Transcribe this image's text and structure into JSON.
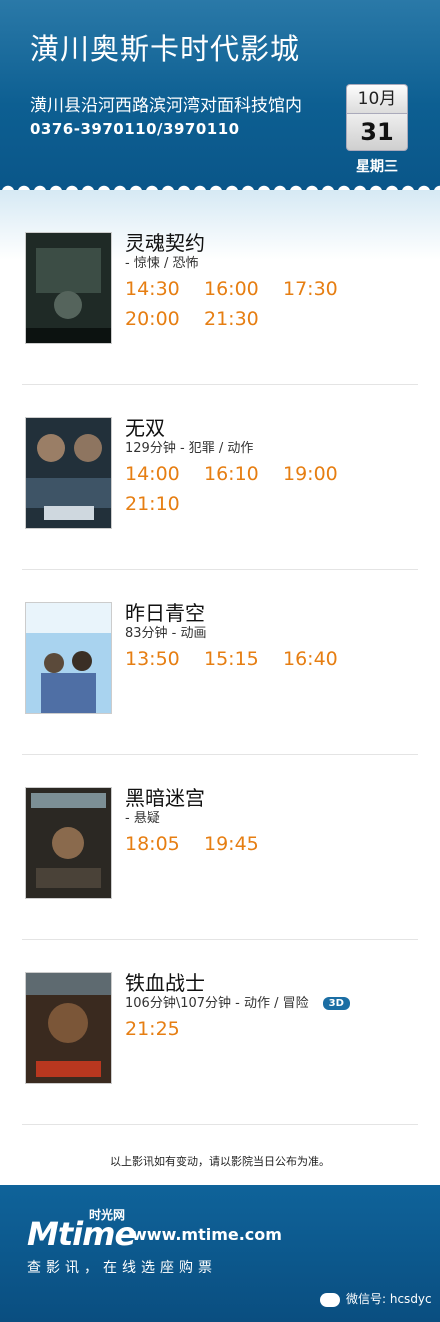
{
  "cinema": {
    "name": "潢川奥斯卡时代影城",
    "address": "潢川县沿河西路滨河湾对面科技馆内",
    "phone": "0376-3970110/3970110"
  },
  "date": {
    "month": "10月",
    "day": "31",
    "weekday": "星期三"
  },
  "movies": [
    {
      "title": "灵魂契约",
      "meta": "- 惊悚 / 恐怖",
      "times": [
        "14:30",
        "16:00",
        "17:30",
        "20:00",
        "21:30"
      ]
    },
    {
      "title": "无双",
      "meta": "129分钟 - 犯罪 / 动作",
      "times": [
        "14:00",
        "16:10",
        "19:00",
        "21:10"
      ]
    },
    {
      "title": "昨日青空",
      "meta": "83分钟 - 动画",
      "times": [
        "13:50",
        "15:15",
        "16:40"
      ]
    },
    {
      "title": "黑暗迷宫",
      "meta": "- 悬疑",
      "times": [
        "18:05",
        "19:45"
      ]
    },
    {
      "title": "铁血战士",
      "meta": "106分钟\\107分钟 - 动作 / 冒险",
      "badge": "3D",
      "times": [
        "21:25"
      ]
    }
  ],
  "notice": "以上影讯如有变动，请以影院当日公布为准。",
  "footer": {
    "logo_text": "Mtime",
    "logo_cn": "时光网",
    "site": "www.mtime.com",
    "slogan": "查影讯，在线选座购票",
    "wechat": "微信号: hcsdyc"
  },
  "colors": {
    "header": "#0d5f92",
    "time": "#e67e12"
  }
}
